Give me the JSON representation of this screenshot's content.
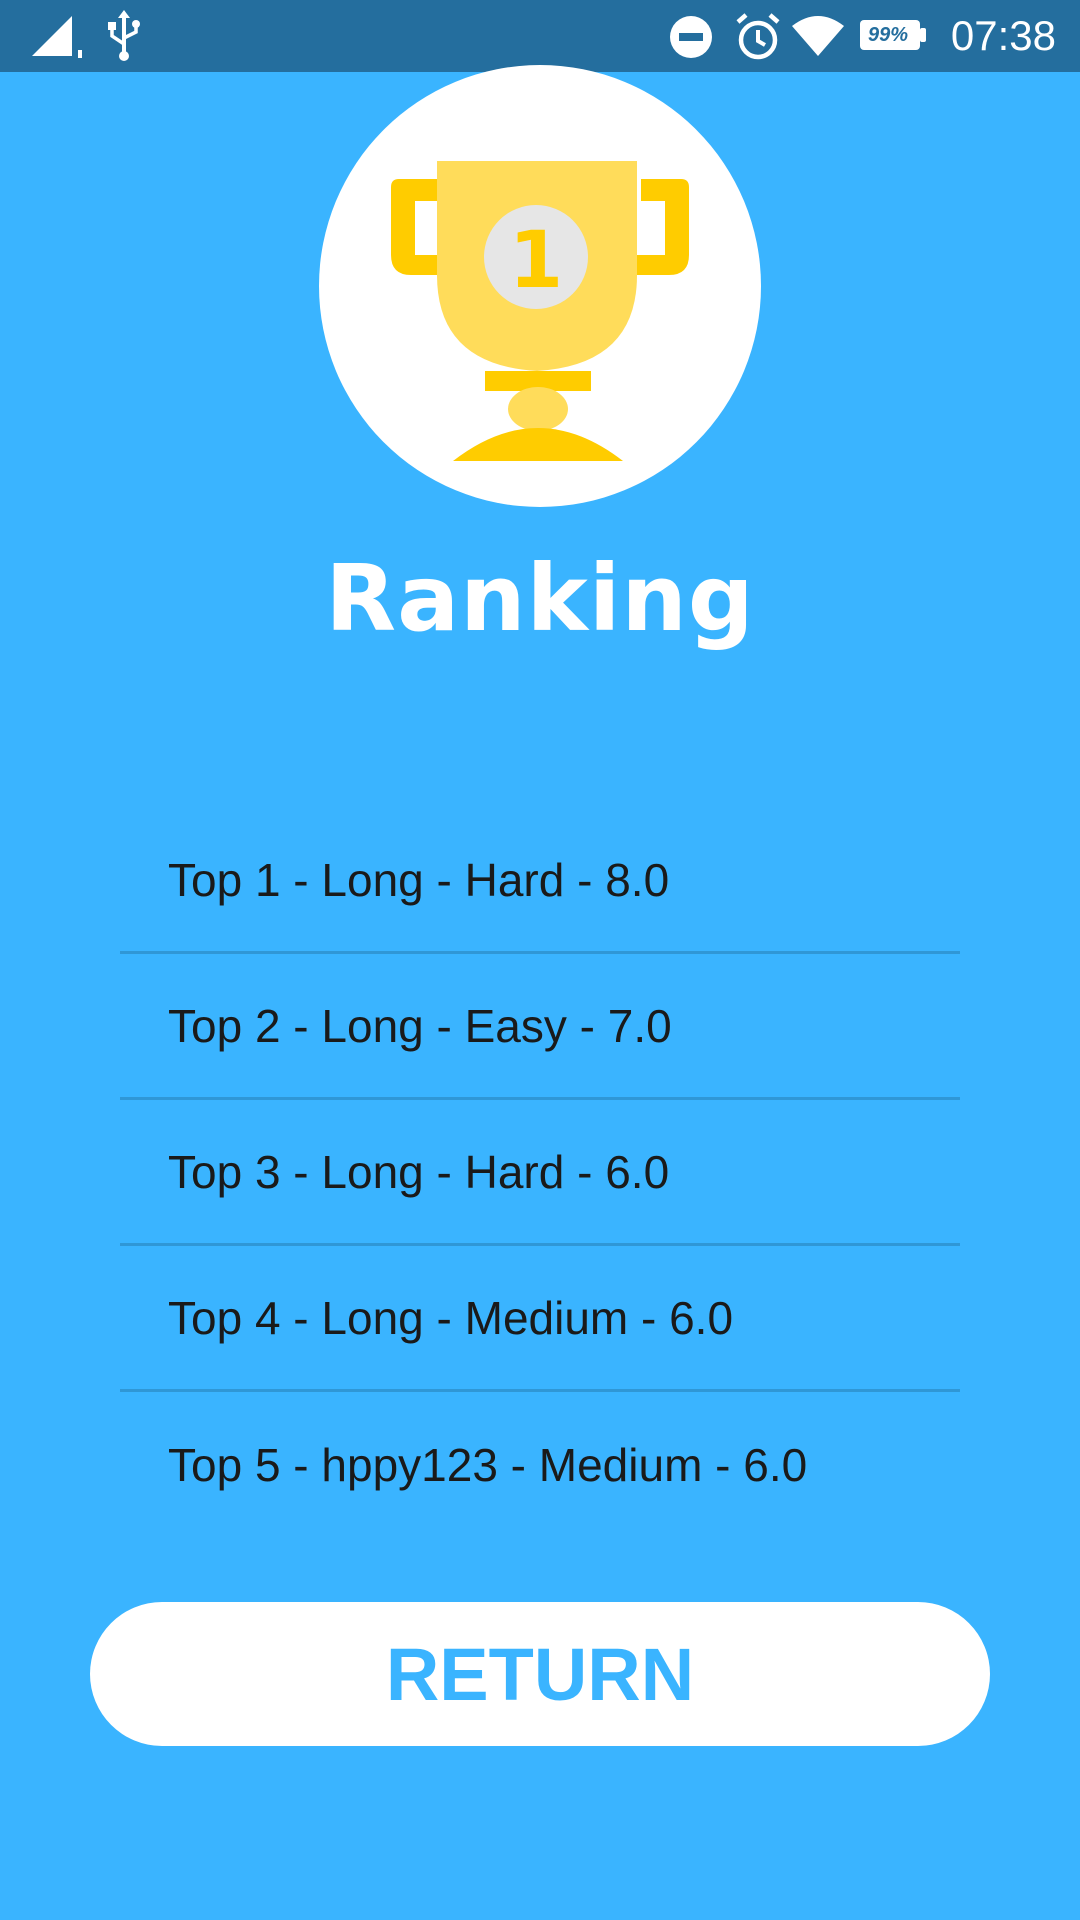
{
  "status_bar": {
    "time": "07:38",
    "battery": "99%",
    "icons": [
      "signal-icon",
      "usb-icon",
      "do-not-disturb-icon",
      "alarm-icon",
      "wifi-icon",
      "battery-icon"
    ]
  },
  "header": {
    "trophy_icon": "trophy-icon",
    "trophy_number": "1",
    "title": "Ranking"
  },
  "ranking": {
    "items": [
      {
        "text": "Top 1 - Long - Hard - 8.0"
      },
      {
        "text": "Top 2 - Long - Easy - 7.0"
      },
      {
        "text": "Top 3 - Long - Hard - 6.0"
      },
      {
        "text": "Top 4 - Long - Medium - 6.0"
      },
      {
        "text": "Top 5 - hppy123 - Medium - 6.0"
      }
    ]
  },
  "actions": {
    "return_label": "RETURN"
  },
  "colors": {
    "background": "#3AB4FF",
    "status_bar": "#246E9E",
    "trophy_gold": "#FFCC00",
    "trophy_light": "#FFDC5A",
    "button_text": "#3AB4FF"
  }
}
